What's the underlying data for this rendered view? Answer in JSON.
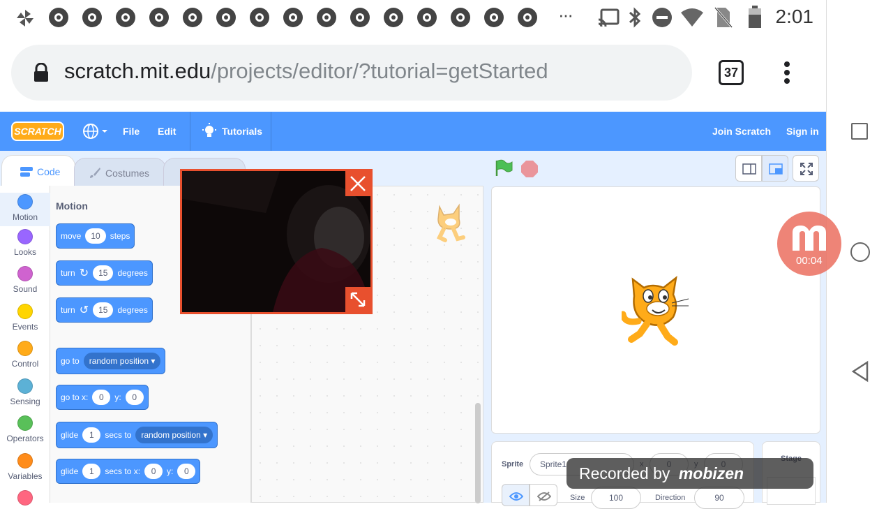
{
  "status_bar": {
    "time": "2:01",
    "icons": [
      "pinwheel-icon",
      "chrome-icon",
      "overflow-icon",
      "cast-icon",
      "bluetooth-icon",
      "dnd-icon",
      "wifi-icon",
      "no-sim-icon",
      "battery-icon"
    ],
    "overflow": "···"
  },
  "browser": {
    "url_host": "scratch.mit.edu",
    "url_path": "/projects/editor/?tutorial=getStarted",
    "tab_count": "37"
  },
  "menubar": {
    "logo": "SCRATCH",
    "file": "File",
    "edit": "Edit",
    "tutorials": "Tutorials",
    "join": "Join Scratch",
    "signin": "Sign in",
    "color": "#4c97ff"
  },
  "tabs": {
    "code": "Code",
    "costumes": "Costumes"
  },
  "categories": [
    {
      "label": "Motion",
      "color": "#4c97ff"
    },
    {
      "label": "Looks",
      "color": "#9966ff"
    },
    {
      "label": "Sound",
      "color": "#cf63cf"
    },
    {
      "label": "Events",
      "color": "#ffd500"
    },
    {
      "label": "Control",
      "color": "#ffab19"
    },
    {
      "label": "Sensing",
      "color": "#5cb1d6"
    },
    {
      "label": "Operators",
      "color": "#59c059"
    },
    {
      "label": "Variables",
      "color": "#ff8c1a"
    }
  ],
  "palette": {
    "heading": "Motion",
    "move": {
      "a": "move",
      "v": "10",
      "b": "steps"
    },
    "turn_right": {
      "a": "turn",
      "v": "15",
      "b": "degrees"
    },
    "turn_left": {
      "a": "turn",
      "v": "15",
      "b": "degrees"
    },
    "goto": {
      "a": "go to",
      "dd": "random position"
    },
    "gotoxy": {
      "a": "go to x:",
      "x": "0",
      "b": "y:",
      "y": "0"
    },
    "glide": {
      "a": "glide",
      "v": "1",
      "b": "secs to",
      "dd": "random position"
    },
    "glidexy": {
      "a": "glide",
      "v": "1",
      "b": "secs to x:",
      "x": "0",
      "c": "y:",
      "y": "0"
    }
  },
  "sprite_info": {
    "sprite_label": "Sprite",
    "sprite_name": "Sprite1",
    "x_label": "x",
    "x": "0",
    "y_label": "y",
    "y": "0",
    "size_label": "Size",
    "size": "100",
    "direction_label": "Direction",
    "direction": "90",
    "stage_label": "Stage"
  },
  "recorder": {
    "time": "00:04",
    "recorded_by": "Recorded by",
    "brand": "mobizen"
  }
}
